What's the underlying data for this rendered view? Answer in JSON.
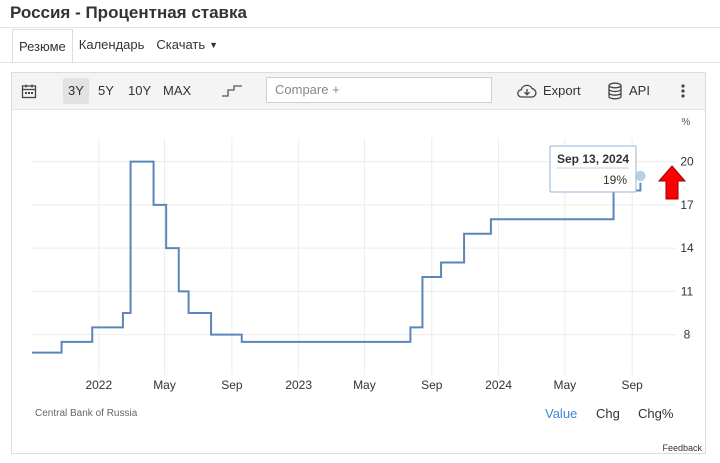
{
  "page": {
    "title": "Россия - Процентная ставка",
    "tabs": [
      {
        "label": "Резюме",
        "active": true
      },
      {
        "label": "Календарь",
        "active": false
      },
      {
        "label": "Скачать",
        "active": false
      }
    ]
  },
  "toolbar": {
    "calendar_icon": "calendar-icon",
    "ranges": [
      "3Y",
      "5Y",
      "10Y",
      "MAX"
    ],
    "active_range": "3Y",
    "step_icon": "step-line-icon",
    "compare_placeholder": "Compare +",
    "export_label": "Export",
    "api_label": "API",
    "more_icon": "more-vertical-icon"
  },
  "chart_data": {
    "type": "line",
    "step": true,
    "y_unit": "%",
    "ylim": [
      5.2,
      21.5
    ],
    "yticks": [
      8,
      11,
      14,
      17,
      20
    ],
    "xlim": [
      "2021-09-01",
      "2024-11-20"
    ],
    "xticks": [
      {
        "label": "2022",
        "date": "2022-01-01"
      },
      {
        "label": "May",
        "date": "2022-05-01"
      },
      {
        "label": "Sep",
        "date": "2022-09-01"
      },
      {
        "label": "2023",
        "date": "2023-01-01"
      },
      {
        "label": "May",
        "date": "2023-05-01"
      },
      {
        "label": "Sep",
        "date": "2023-09-01"
      },
      {
        "label": "2024",
        "date": "2024-01-01"
      },
      {
        "label": "May",
        "date": "2024-05-01"
      },
      {
        "label": "Sep",
        "date": "2024-09-01"
      }
    ],
    "grid": true,
    "line_color": "#5b86b8",
    "series": [
      {
        "points": [
          [
            "2021-09-01",
            6.75
          ],
          [
            "2021-10-25",
            7.5
          ],
          [
            "2021-12-20",
            8.5
          ],
          [
            "2022-02-14",
            9.5
          ],
          [
            "2022-02-28",
            20
          ],
          [
            "2022-04-11",
            17
          ],
          [
            "2022-05-04",
            14
          ],
          [
            "2022-05-27",
            11
          ],
          [
            "2022-06-14",
            9.5
          ],
          [
            "2022-07-25",
            8
          ],
          [
            "2022-09-19",
            7.5
          ],
          [
            "2023-07-24",
            8.5
          ],
          [
            "2023-08-15",
            12
          ],
          [
            "2023-09-18",
            13
          ],
          [
            "2023-10-30",
            15
          ],
          [
            "2023-12-18",
            16
          ],
          [
            "2024-07-29",
            18
          ],
          [
            "2024-09-16",
            19
          ],
          [
            "2024-09-16",
            19
          ]
        ]
      }
    ],
    "tooltip": {
      "date": "Sep 13, 2024",
      "value": "19%"
    },
    "marker_color": "#ff0000",
    "source": "Central Bank of Russia",
    "modes": [
      "Value",
      "Chg",
      "Chg%"
    ],
    "active_mode": "Value"
  },
  "feedback_label": "Feedback"
}
